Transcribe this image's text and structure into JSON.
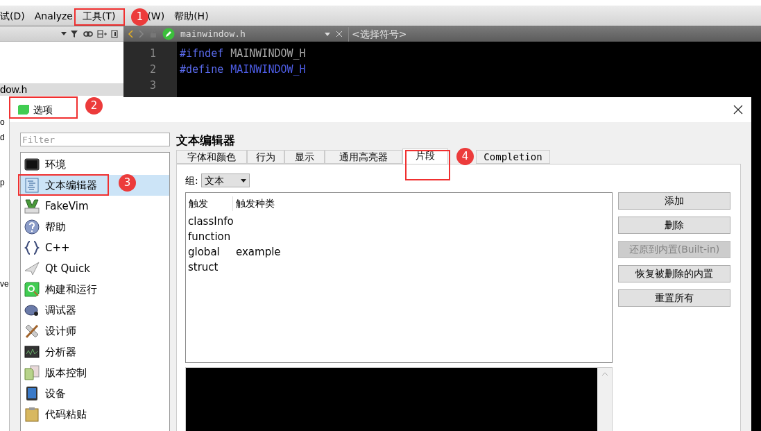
{
  "menu_bar": {
    "items": [
      {
        "label": "试(D)"
      },
      {
        "label": "Analyze"
      },
      {
        "label": "工具(T)"
      },
      {
        "label": "(W)"
      },
      {
        "label": "帮助(H)"
      }
    ]
  },
  "project_panel": {
    "file_fragment": "dow.h",
    "side_fragments": [
      {
        "text": "o"
      },
      {
        "text": "d"
      },
      {
        "text": "p"
      },
      {
        "text": "ve"
      }
    ]
  },
  "editor": {
    "file": "mainwindow.h",
    "symbol": "<选择符号>",
    "lines": [
      {
        "number": "1",
        "tokens": [
          {
            "text": "#ifndef",
            "kind": "directive"
          },
          {
            "text": "MAINWINDOW_H",
            "kind": "plain"
          }
        ]
      },
      {
        "number": "2",
        "tokens": [
          {
            "text": "#define",
            "kind": "directive"
          },
          {
            "text": "MAINWINDOW_H",
            "kind": "macro"
          }
        ]
      },
      {
        "number": "3"
      }
    ]
  },
  "dialog": {
    "title": "选项",
    "filter": {
      "placeholder": "Filter"
    },
    "categories": [
      {
        "label": "环境",
        "selected": false
      },
      {
        "label": "文本编辑器",
        "selected": true
      },
      {
        "label": "FakeVim",
        "selected": false
      },
      {
        "label": "帮助",
        "selected": false
      },
      {
        "label": "C++",
        "selected": false
      },
      {
        "label": "Qt Quick",
        "selected": false
      },
      {
        "label": "构建和运行",
        "selected": false
      },
      {
        "label": "调试器",
        "selected": false
      },
      {
        "label": "设计师",
        "selected": false
      },
      {
        "label": "分析器",
        "selected": false
      },
      {
        "label": "版本控制",
        "selected": false
      },
      {
        "label": "设备",
        "selected": false
      },
      {
        "label": "代码粘贴",
        "selected": false
      }
    ],
    "page_title": "文本编辑器",
    "tabs": [
      {
        "label": "字体和颜色",
        "selected": false
      },
      {
        "label": "行为",
        "selected": false
      },
      {
        "label": "显示",
        "selected": false
      },
      {
        "label": "通用高亮器",
        "selected": false
      },
      {
        "label": "片段",
        "selected": true
      },
      {
        "label": "Completion",
        "selected": false
      }
    ],
    "group": {
      "label": "组:",
      "value": "文本"
    },
    "table": {
      "columns": [
        "触发",
        "触发种类"
      ],
      "rows": [
        [
          "classInfo",
          ""
        ],
        [
          "function",
          ""
        ],
        [
          "global",
          "example"
        ],
        [
          "struct",
          ""
        ]
      ]
    },
    "buttons": [
      {
        "label": "添加",
        "disabled": false
      },
      {
        "label": "删除",
        "disabled": false
      },
      {
        "label": "还原到内置(Built-in)",
        "disabled": true
      },
      {
        "label": "恢复被删除的内置",
        "disabled": false
      },
      {
        "label": "重置所有",
        "disabled": false
      }
    ]
  },
  "annotations": [
    {
      "number": "1"
    },
    {
      "number": "2"
    },
    {
      "number": "3"
    },
    {
      "number": "4"
    }
  ]
}
